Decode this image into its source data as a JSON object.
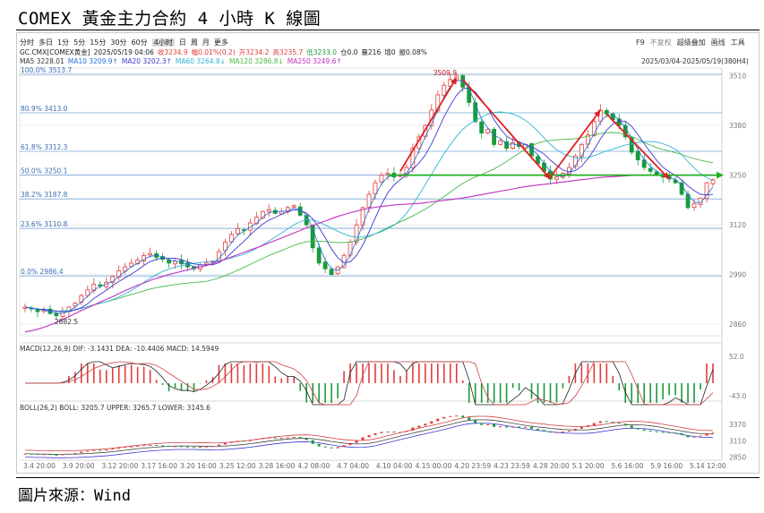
{
  "title": "COMEX 黃金主力合約 4 小時 K 線圖",
  "source": "圖片來源：Wind",
  "toolbar": {
    "periods": [
      "分时",
      "多日",
      "1分",
      "5分",
      "15分",
      "30分",
      "60分",
      "4小时",
      "日",
      "周",
      "月",
      "更多"
    ],
    "selected": "4小时",
    "right": [
      "F9",
      "不复权",
      "超级叠加",
      "画线",
      "工具"
    ]
  },
  "header": {
    "line1": [
      "GC.CMX[COMEX黄金]",
      "2025/05/19 04:06",
      "收3234.9",
      "幅0.01%(0.2)",
      "开3234.2",
      "高3235.7",
      "低3233.0",
      "仓0.0",
      "量216",
      "增0",
      "振0.08%"
    ],
    "line2": [
      "MA5 3228.01",
      "MA10 3209.9↑",
      "MA20 3202.3↑",
      "MA60 3264.8↓",
      "MA120 3286.8↓",
      "MA250 3249.6↑"
    ],
    "line2_colors": [
      "#333333",
      "#1f6fd6",
      "#3a3ad0",
      "#2fb4d6",
      "#47b847",
      "#c030c0"
    ],
    "date_range": "2025/03/04-2025/05/19(380H4)"
  },
  "macd_header": "MACD(12,26,9) DIF: -3.1431  DEA: -10.4406  MACD: 14.5949",
  "boll_header": "BOLL(26,2) BOLL: 3205.7  UPPER: 3265.7  LOWER: 3145.6",
  "colors": {
    "up": "#e23c3c",
    "down": "#1a9a3a",
    "fib": "#7aa6d8",
    "arrow": "#e02020",
    "neckline": "#22b022",
    "ma250": "#c030c0",
    "ma120": "#47b847",
    "ma60": "#2fb4d6",
    "ma20": "#3a3ad0",
    "ma10": "#1f6fd6"
  },
  "chart_data": {
    "type": "candlestick",
    "title": "COMEX 黃金主力合約 4 小時 K 線圖",
    "y_axis": {
      "ticks": [
        3510,
        3380,
        3250,
        3120,
        2990,
        2860
      ],
      "range": [
        2830,
        3530
      ]
    },
    "x_axis": {
      "ticks": [
        "3.4 20:00",
        "3.9 20:00",
        "3.12 20:00",
        "3.17 16:00",
        "3.20 16:00",
        "3.25 12:00",
        "3.28 16:00",
        "4.2 08:00",
        "4.7 04:00",
        "4.10 04:00",
        "4.15 00:00",
        "4.20 23:59",
        "4.23 23:59",
        "4.28 20:00",
        "5.1 20:00",
        "5.6 16:00",
        "5.9 16:00",
        "5.14 12:00"
      ]
    },
    "fibonacci": [
      {
        "label": "100.0%",
        "value": 3513.7
      },
      {
        "label": "80.9%",
        "value": 3413.0
      },
      {
        "label": "61.8%",
        "value": 3312.3
      },
      {
        "label": "50.0%",
        "value": 3250.1
      },
      {
        "label": "38.2%",
        "value": 3187.8
      },
      {
        "label": "23.6%",
        "value": 3110.8
      },
      {
        "label": "0.0%",
        "value": 2986.4
      }
    ],
    "annotations": {
      "high": "3509.9",
      "low": "2882.5",
      "neckline": 3250
    },
    "path": [
      2905,
      2900,
      2893,
      2898,
      2888,
      2882,
      2895,
      2905,
      2915,
      2935,
      2950,
      2965,
      2960,
      2970,
      2985,
      3000,
      3010,
      3020,
      3028,
      3040,
      3045,
      3035,
      3030,
      3020,
      3025,
      3018,
      3010,
      3005,
      3015,
      3020,
      3025,
      3050,
      3075,
      3095,
      3110,
      3105,
      3125,
      3140,
      3155,
      3160,
      3150,
      3155,
      3165,
      3170,
      3145,
      3120,
      3060,
      3020,
      3005,
      2990,
      3010,
      3040,
      3075,
      3120,
      3165,
      3200,
      3230,
      3250,
      3255,
      3245,
      3250,
      3270,
      3320,
      3350,
      3380,
      3420,
      3460,
      3485,
      3500,
      3509,
      3480,
      3440,
      3390,
      3360,
      3370,
      3330,
      3340,
      3320,
      3335,
      3325,
      3330,
      3300,
      3280,
      3260,
      3240,
      3245,
      3255,
      3270,
      3300,
      3330,
      3355,
      3390,
      3420,
      3410,
      3395,
      3380,
      3350,
      3310,
      3290,
      3270,
      3260,
      3250,
      3245,
      3240,
      3230,
      3200,
      3165,
      3175,
      3190,
      3230,
      3238
    ],
    "ma250": [
      2840,
      2843,
      2847,
      2852,
      2858,
      2865,
      2872,
      2880,
      2888,
      2896,
      2903,
      2910,
      2918,
      2925,
      2932,
      2940,
      2948,
      2955,
      2962,
      2968,
      2975,
      2980,
      2985,
      2990,
      2994,
      2998,
      3002,
      3006,
      3010,
      3014,
      3019,
      3024,
      3030,
      3036,
      3042,
      3048,
      3054,
      3060,
      3066,
      3073,
      3079,
      3086,
      3092,
      3099,
      3105,
      3112,
      3118,
      3124,
      3130,
      3136,
      3142,
      3147,
      3152,
      3156,
      3160,
      3163,
      3166,
      3168,
      3170,
      3172,
      3173,
      3174,
      3175,
      3176,
      3178,
      3180,
      3182,
      3184,
      3186,
      3188,
      3190,
      3193,
      3196,
      3199,
      3202,
      3205,
      3208,
      3211,
      3214,
      3217,
      3220,
      3222,
      3224,
      3226,
      3228,
      3230,
      3232,
      3234,
      3236,
      3238,
      3240,
      3242,
      3244,
      3245,
      3246,
      3247,
      3248,
      3249,
      3249,
      3250,
      3250,
      3250,
      3250,
      3250,
      3250,
      3250,
      3250,
      3250,
      3250,
      3250,
      3250
    ],
    "macd": {
      "dif": -3.1431,
      "dea": -10.4406,
      "macd": 14.5949,
      "ticks": [
        52.0,
        -43.0
      ]
    },
    "boll": {
      "mid": 3205.7,
      "upper": 3265.7,
      "lower": 3145.6,
      "ticks": [
        3370,
        3110,
        2850
      ]
    }
  }
}
